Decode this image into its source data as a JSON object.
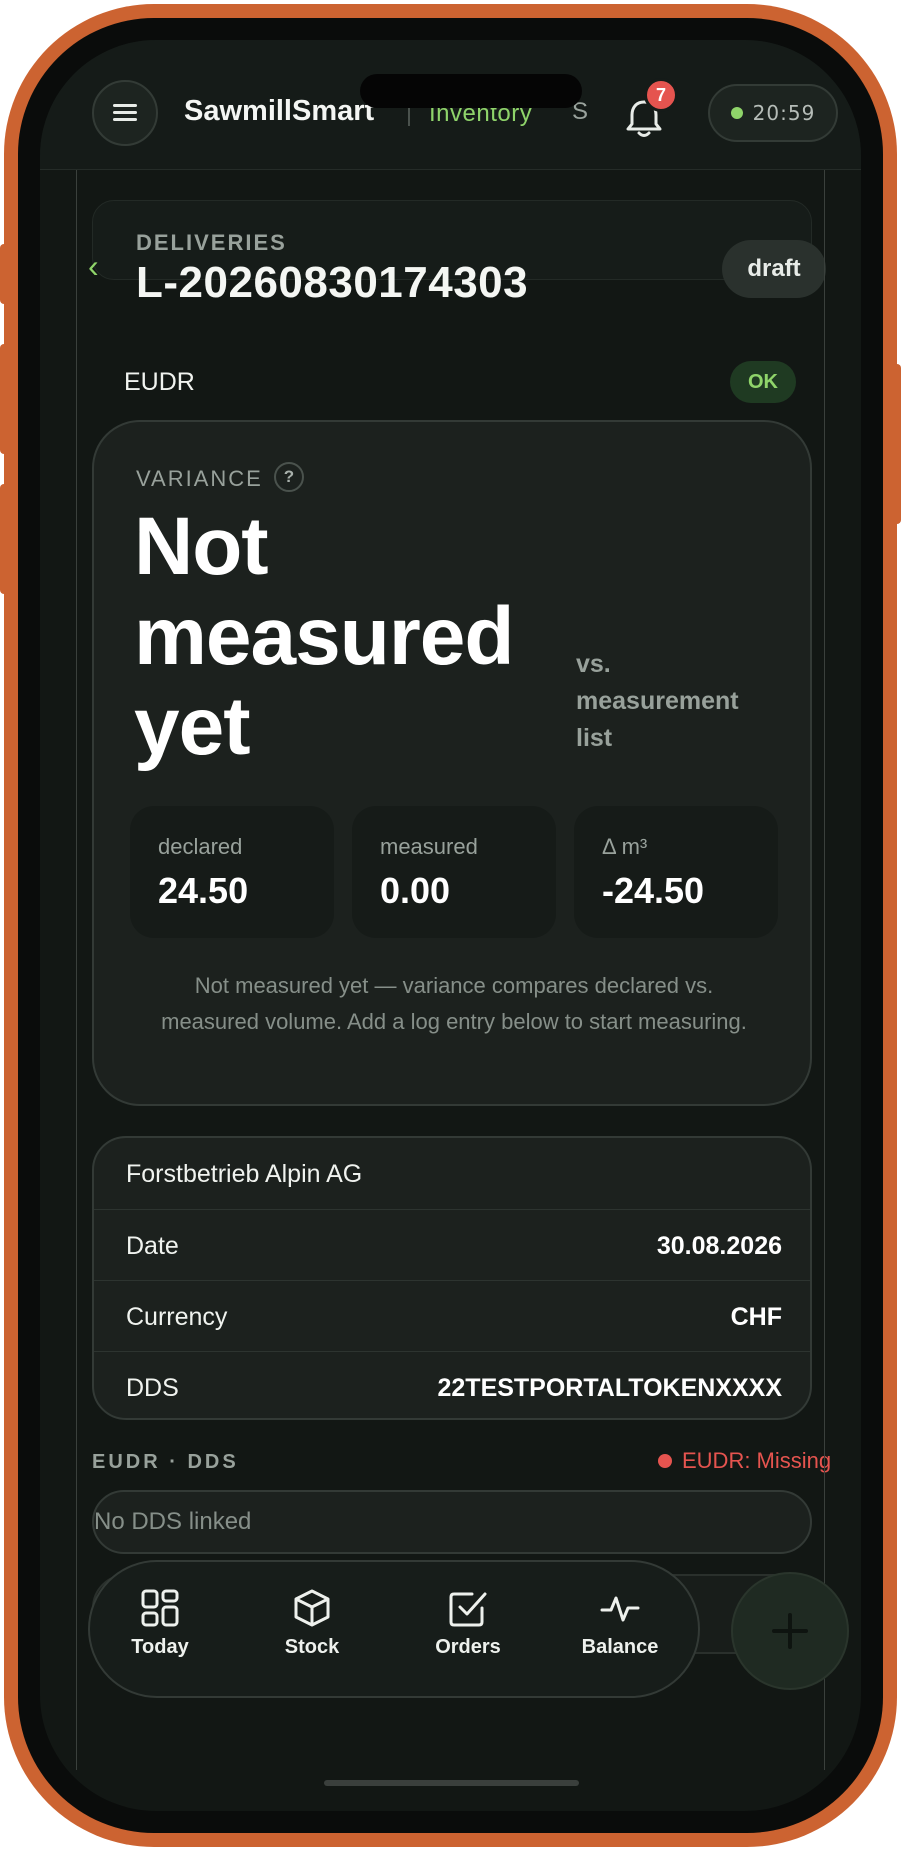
{
  "header": {
    "app_name": "SawmillSmart",
    "section": "Inventory",
    "more_initial": "S",
    "notification_count": "7",
    "clock": "20:59"
  },
  "page": {
    "breadcrumb": "DELIVERIES",
    "title": "L-20260830174303",
    "status": "draft",
    "back_glyph": "‹"
  },
  "eudr": {
    "label": "EUDR",
    "status": "OK"
  },
  "variance": {
    "label": "VARIANCE",
    "help_glyph": "?",
    "headline": "Not measured yet",
    "comparison": "vs. measurement list",
    "stats": [
      {
        "label": "declared",
        "value": "24.50"
      },
      {
        "label": "measured",
        "value": "0.00"
      },
      {
        "label": "Δ m³",
        "value": "-24.50"
      }
    ],
    "note": "Not measured yet — variance compares declared vs. measured volume. Add a log entry below to start measuring."
  },
  "details": {
    "supplier": "Forstbetrieb Alpin AG",
    "rows": [
      {
        "label": "Date",
        "value": "30.08.2026"
      },
      {
        "label": "Currency",
        "value": "CHF"
      },
      {
        "label": "DDS",
        "value": "22TESTPORTALTOKENXXXX"
      }
    ]
  },
  "eudr_dds": {
    "section_label": "EUDR · DDS",
    "status_text": "EUDR: Missing",
    "status_color": "#e5544f",
    "input_placeholder": "No DDS linked"
  },
  "tabbar": {
    "items": [
      {
        "label": "Today",
        "icon": "grid-icon"
      },
      {
        "label": "Stock",
        "icon": "box-icon"
      },
      {
        "label": "Orders",
        "icon": "checkbox-icon"
      },
      {
        "label": "Balance",
        "icon": "pulse-icon"
      }
    ],
    "fab_icon": "plus-icon"
  },
  "colors": {
    "accent": "#8fd46a",
    "frame": "#cc6331",
    "background": "#121714",
    "danger": "#e5544f"
  }
}
